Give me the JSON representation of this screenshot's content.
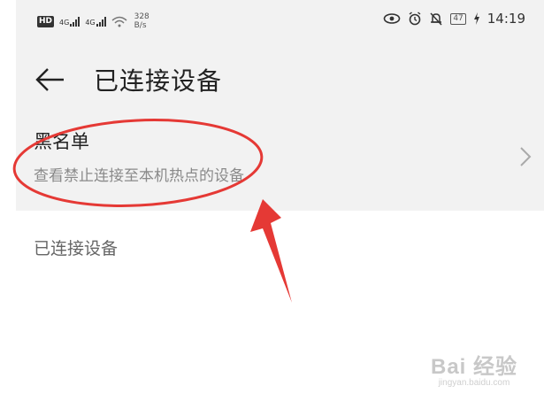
{
  "status_bar": {
    "hd_badge": "HD",
    "sim1_label": "4G",
    "sim2_label": "4G",
    "network_speed_value": "328",
    "network_speed_unit": "B/s",
    "battery_level": "47",
    "time": "14:19"
  },
  "header": {
    "title": "已连接设备"
  },
  "blacklist": {
    "title": "黑名单",
    "subtitle": "查看禁止连接至本机热点的设备"
  },
  "section": {
    "label": "已连接设备"
  },
  "watermark": {
    "brand": "Bai 经验",
    "url": "jingyan.baidu.com"
  },
  "colors": {
    "annotation_red": "#e53935",
    "gray_background": "#f2f2f2"
  }
}
